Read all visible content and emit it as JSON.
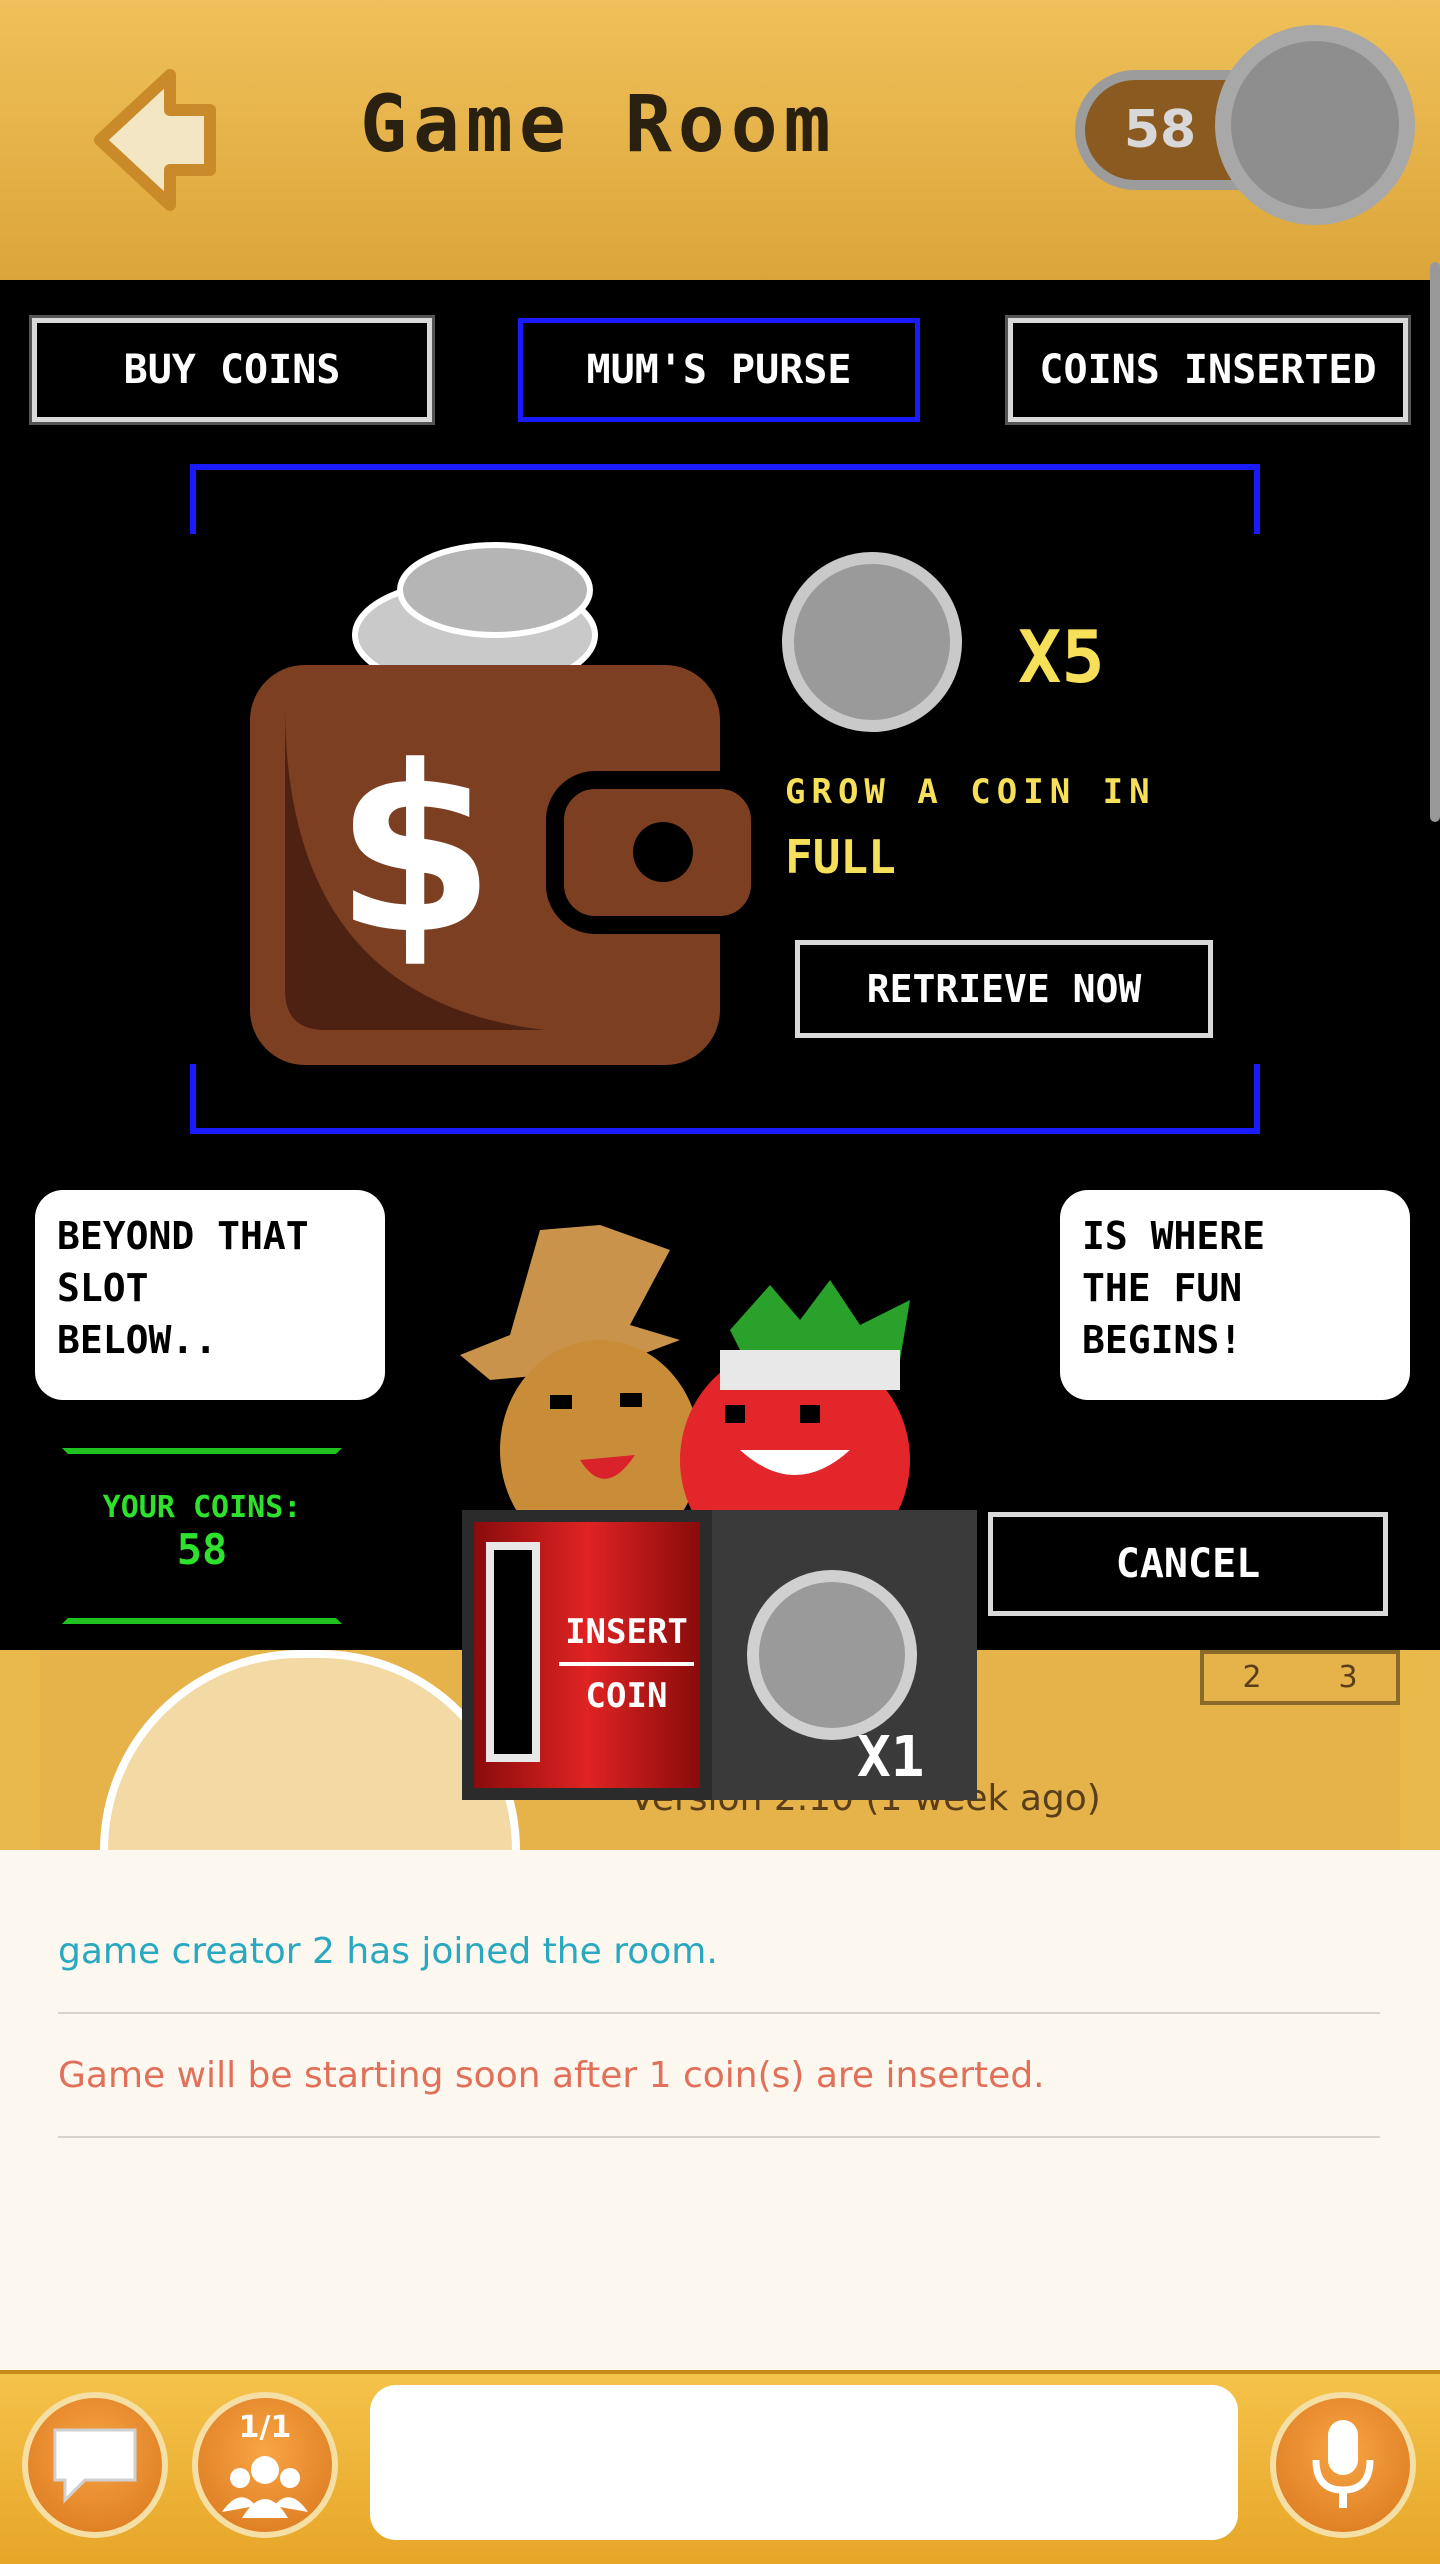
{
  "header": {
    "title": "Game Room",
    "coin_count": "58"
  },
  "tabs": [
    {
      "label": "BUY COINS"
    },
    {
      "label": "MUM'S PURSE"
    },
    {
      "label": "COINS INSERTED"
    }
  ],
  "purse": {
    "multiplier": "X5",
    "grow_text": "GROW A COIN IN",
    "status": "FULL",
    "retrieve_label": "RETRIEVE NOW"
  },
  "bubbles": {
    "left": [
      "BEYOND THAT",
      "SLOT",
      "BELOW.."
    ],
    "right": [
      "IS WHERE",
      "THE FUN",
      "BEGINS!"
    ]
  },
  "your_coins": {
    "label": "YOUR COINS:",
    "value": "58"
  },
  "cancel_label": "CANCEL",
  "machine": {
    "insert_line1": "INSERT",
    "insert_line2": "COIN",
    "cost": "X1"
  },
  "game_card": {
    "version_text": "Version 2.10 (1 week ago)",
    "numbers": [
      "2",
      "3"
    ]
  },
  "chat": {
    "messages": [
      {
        "text": "game creator 2 has joined the room."
      },
      {
        "text": "Game will be starting soon after 1 coin(s) are inserted."
      }
    ]
  },
  "bottom_bar": {
    "users_count": "1/1",
    "input_placeholder": ""
  },
  "colors": {
    "modal_bg": "#000000",
    "accent_yellow": "#f6e05a",
    "accent_green": "#2de12d",
    "tab_active_border": "#1a1aff",
    "chat_join": "#2aa8c0",
    "chat_system": "#e0705a"
  },
  "icons": [
    "back-arrow-icon",
    "coin-icon",
    "wallet-icon",
    "chat-bubble-icon",
    "users-icon",
    "microphone-icon"
  ]
}
